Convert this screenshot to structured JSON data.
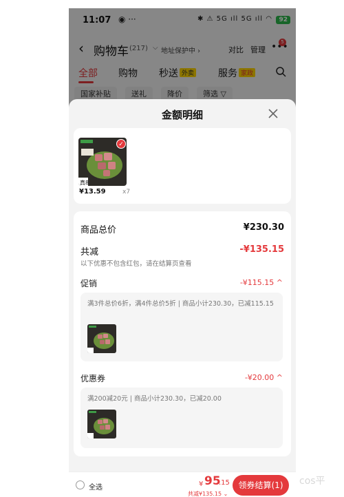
{
  "status_bar": {
    "time": "11:07",
    "extra": "◉ ···",
    "icons": "✱ ⚠ 5G ıll 5G ıll ◠",
    "battery": "92"
  },
  "header": {
    "title": "购物车",
    "count": "(217)",
    "address": "地址保护中 ›",
    "compare": "对比",
    "manage": "管理",
    "more_badge": "5"
  },
  "tabs": [
    {
      "label": "全部"
    },
    {
      "label": "购物"
    },
    {
      "label": "秒送",
      "tag": "外卖"
    },
    {
      "label": "服务",
      "tag": "家政"
    }
  ],
  "chips": [
    "国家补贴",
    "送礼",
    "降价",
    "筛选 ▽"
  ],
  "sheet": {
    "title": "金额明细",
    "product": {
      "price": "¥13.59",
      "qty": "x7",
      "thumb_text": "真8"
    },
    "total": {
      "label": "商品总价",
      "value": "¥230.30"
    },
    "reduce": {
      "label": "共减",
      "value": "-¥135.15",
      "note": "以下优惠不包含红包，请在结算页查看"
    },
    "promo": {
      "label": "促销",
      "value": "-¥115.15 ^",
      "text": "满3件总价6折，满4件总价5折 | 商品小计230.30，已减115.15"
    },
    "coupon": {
      "label": "优惠券",
      "value": "-¥20.00 ^",
      "text": "满200减20元 | 商品小计230.30，已减20.00"
    }
  },
  "bottom": {
    "select_all": "全选",
    "currency": "¥",
    "total_int": "95",
    "total_dec": ".15",
    "saved": "共减¥135.15 ⌄",
    "checkout": "领券结算(1)"
  },
  "watermark": "cos平",
  "colors": {
    "accent": "#e4393c",
    "tag_yellow": "#ffd500"
  }
}
